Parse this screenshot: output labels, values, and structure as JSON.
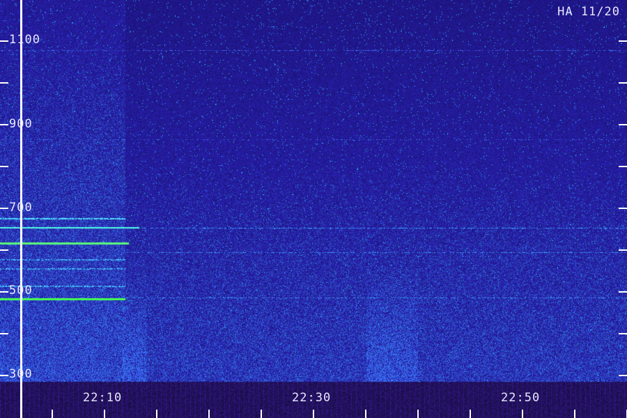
{
  "station_label": "HA 11/20",
  "y_axis": {
    "tick_labels": [
      "1100",
      "900",
      "700",
      "500",
      "300"
    ],
    "range": [
      300,
      1100
    ]
  },
  "x_axis": {
    "tick_labels": [
      "22:10",
      "22:30",
      "22:50"
    ]
  },
  "colors": {
    "background": "#1a0a9a",
    "strong_signal": "#30ff60",
    "medium_signal": "#30c8ff",
    "axis": "#ffffff"
  }
}
